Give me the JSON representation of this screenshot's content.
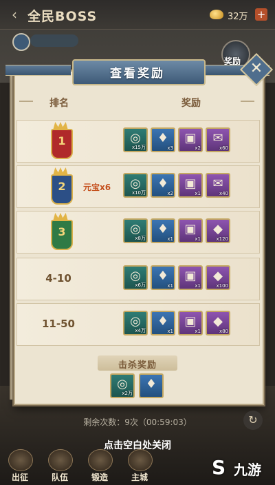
{
  "topbar": {
    "back_glyph": "‹",
    "title": "全民BOSS",
    "currency_value": "32万",
    "plus_glyph": "+"
  },
  "background": {
    "reward_label": "奖励"
  },
  "dialog": {
    "title": "查看奖励",
    "close_glyph": "✕",
    "header": {
      "rank": "排名",
      "reward": "奖励"
    },
    "ranks": [
      {
        "rank": "1",
        "medal_color": "#b02a2a",
        "extra": "",
        "items": [
          {
            "kind": "coin",
            "color": "green",
            "count": "x15万"
          },
          {
            "kind": "armor",
            "color": "blue",
            "count": "x3"
          },
          {
            "kind": "chest",
            "color": "purple",
            "count": "x2"
          },
          {
            "kind": "scroll",
            "color": "purple",
            "count": "x60"
          }
        ]
      },
      {
        "rank": "2",
        "medal_color": "#2c4f86",
        "extra": "元宝x6",
        "items": [
          {
            "kind": "coin",
            "color": "green",
            "count": "x10万"
          },
          {
            "kind": "armor",
            "color": "blue",
            "count": "x2"
          },
          {
            "kind": "chest",
            "color": "purple",
            "count": "x1"
          },
          {
            "kind": "scroll",
            "color": "purple",
            "count": "x40"
          }
        ]
      },
      {
        "rank": "3",
        "medal_color": "#2f7a45",
        "extra": "",
        "items": [
          {
            "kind": "coin",
            "color": "green",
            "count": "x8万"
          },
          {
            "kind": "armor",
            "color": "blue",
            "count": "x1"
          },
          {
            "kind": "chest",
            "color": "purple",
            "count": "x1"
          },
          {
            "kind": "gem",
            "color": "purple",
            "count": "x120"
          }
        ]
      },
      {
        "rank": "4-10",
        "medal_color": "",
        "extra": "",
        "items": [
          {
            "kind": "coin",
            "color": "green",
            "count": "x6万"
          },
          {
            "kind": "armor",
            "color": "blue",
            "count": "x1"
          },
          {
            "kind": "chest",
            "color": "purple",
            "count": "x1"
          },
          {
            "kind": "gem",
            "color": "purple",
            "count": "x100"
          }
        ]
      },
      {
        "rank": "11-50",
        "medal_color": "",
        "extra": "",
        "items": [
          {
            "kind": "coin",
            "color": "green",
            "count": "x4万"
          },
          {
            "kind": "armor",
            "color": "blue",
            "count": "x1"
          },
          {
            "kind": "chest",
            "color": "purple",
            "count": "x1"
          },
          {
            "kind": "gem",
            "color": "purple",
            "count": "x80"
          }
        ]
      }
    ],
    "kill_reward": {
      "title": "击杀奖励",
      "items": [
        {
          "kind": "coin",
          "color": "green",
          "count": "x2万"
        },
        {
          "kind": "armor",
          "color": "blue",
          "count": ""
        }
      ]
    }
  },
  "footer": {
    "remaining": "剩余次数：9次（00:59:03）",
    "close_hint": "点击空白处关闭"
  },
  "nav": [
    {
      "label": "出征"
    },
    {
      "label": "队伍"
    },
    {
      "label": "锻造"
    },
    {
      "label": "主城"
    }
  ],
  "watermark": {
    "logo": "S",
    "text": "九游"
  },
  "icons": {
    "coin": "◎",
    "armor": "♦",
    "chest": "▣",
    "scroll": "✉",
    "gem": "◆"
  }
}
